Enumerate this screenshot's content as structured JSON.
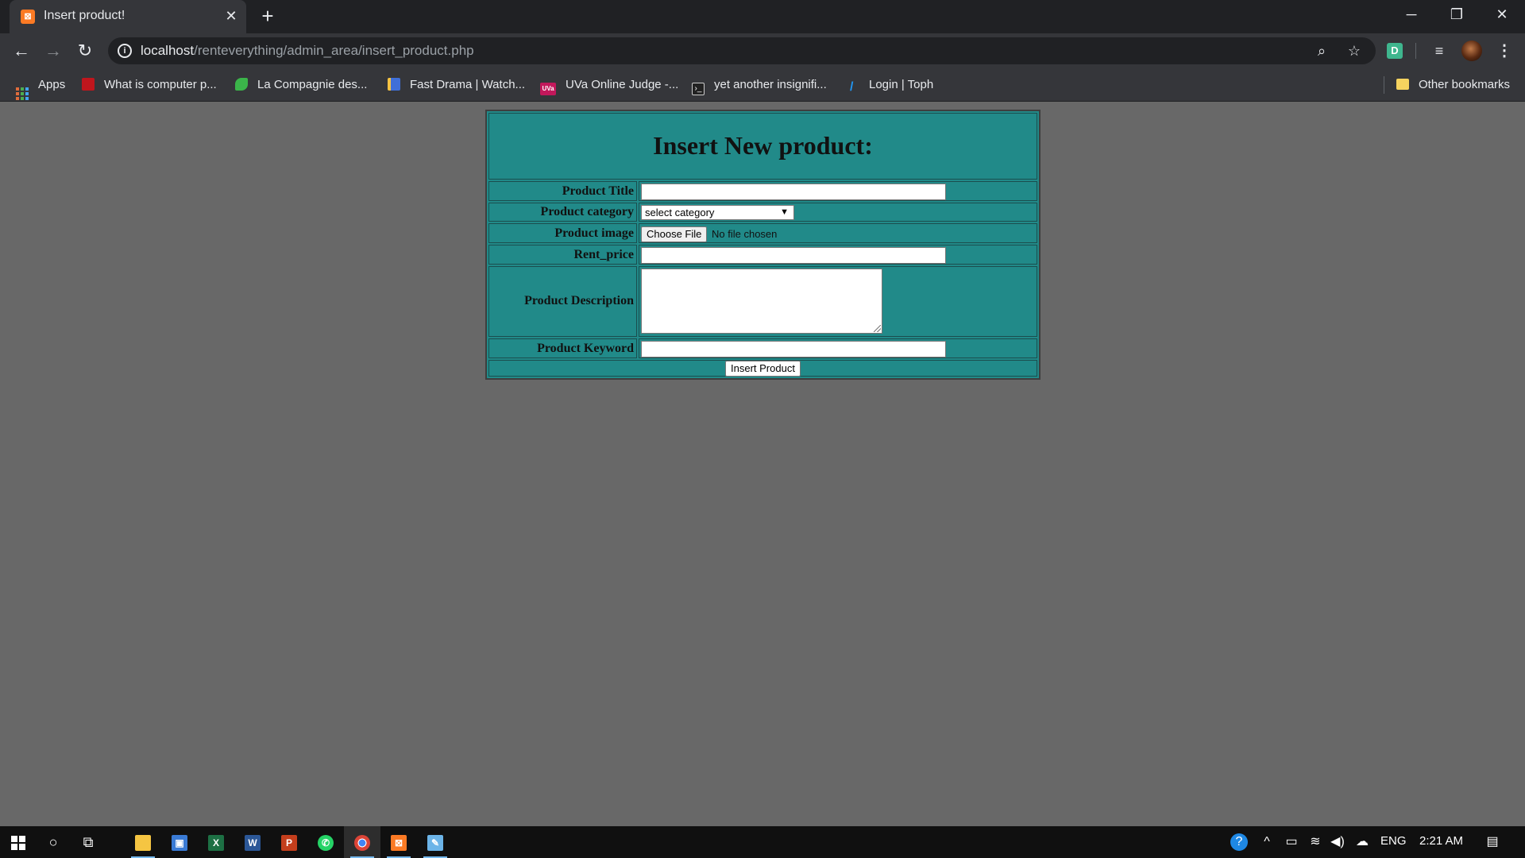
{
  "browser": {
    "tab": {
      "title": "Insert product!",
      "favicon": "xampp-icon"
    },
    "address": {
      "host": "localhost",
      "path": "/renteverything/admin_area/insert_product.php"
    },
    "extension_badge": "D",
    "bookmarks": [
      {
        "label": "Apps",
        "icon": "apps-grid-icon"
      },
      {
        "label": "What is computer p...",
        "icon": "red-square-icon",
        "color": "#c0161d"
      },
      {
        "label": "La Compagnie des...",
        "icon": "green-leaf-icon",
        "color": "#3bb54a"
      },
      {
        "label": "Fast Drama | Watch...",
        "icon": "book-icon",
        "color": "#3f6fd8"
      },
      {
        "label": "UVa Online Judge -...",
        "icon": "uva-icon",
        "color": "#c2185b"
      },
      {
        "label": "yet another insignifi...",
        "icon": "terminal-icon",
        "color": "#222222"
      },
      {
        "label": "Login | Toph",
        "icon": "toph-icon",
        "color": "#2196f3"
      }
    ],
    "other_bookmarks": "Other bookmarks"
  },
  "form": {
    "heading": "Insert New product:",
    "labels": {
      "title": "Product Title",
      "category": "Product category",
      "image": "Product image",
      "rent_price": "Rent_price",
      "description": "Product Description",
      "keyword": "Product Keyword"
    },
    "category_select": {
      "selected": "select category"
    },
    "file_input": {
      "button": "Choose File",
      "status": "No file chosen"
    },
    "submit_label": "Insert Product",
    "background_color": "#218a89"
  },
  "taskbar": {
    "language": "ENG",
    "time": "2:21 AM"
  }
}
